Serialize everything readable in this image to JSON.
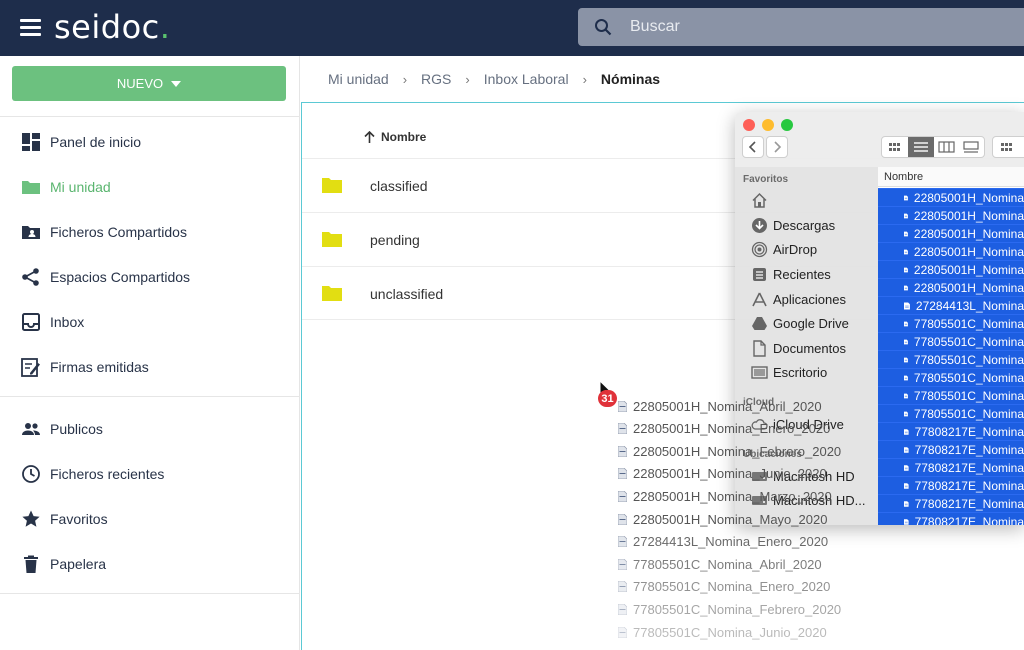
{
  "app": {
    "logo_text": "seidoc",
    "logo_dot": ".",
    "accent": "#6cc17f",
    "topbar_color": "#1e2d4b"
  },
  "search": {
    "placeholder": "Buscar"
  },
  "sidebar": {
    "new_button": "NUEVO",
    "items": [
      {
        "label": "Panel de inicio",
        "icon": "dashboard-icon"
      },
      {
        "label": "Mi unidad",
        "icon": "folder-icon",
        "active": true
      },
      {
        "label": "Ficheros Compartidos",
        "icon": "shared-folder-icon"
      },
      {
        "label": "Espacios Compartidos",
        "icon": "share-icon"
      },
      {
        "label": "Inbox",
        "icon": "inbox-icon"
      },
      {
        "label": "Firmas emitidas",
        "icon": "signature-icon"
      }
    ],
    "items2": [
      {
        "label": "Publicos",
        "icon": "people-icon"
      },
      {
        "label": "Ficheros recientes",
        "icon": "clock-icon"
      },
      {
        "label": "Favoritos",
        "icon": "star-icon"
      },
      {
        "label": "Papelera",
        "icon": "trash-icon"
      }
    ]
  },
  "breadcrumb": [
    "Mi unidad",
    "RGS",
    "Inbox Laboral",
    "Nóminas"
  ],
  "table": {
    "column": "Nombre",
    "rows": [
      "classified",
      "pending",
      "unclassified"
    ]
  },
  "drag": {
    "count": "31",
    "files": [
      "22805001H_Nomina_Abril_2020",
      "22805001H_Nomina_Enero_2020",
      "22805001H_Nomina_Febrero_2020",
      "22805001H_Nomina_Junio_2020",
      "22805001H_Nomina_Marzo_2020",
      "22805001H_Nomina_Mayo_2020",
      "27284413L_Nomina_Enero_2020",
      "77805501C_Nomina_Abril_2020",
      "77805501C_Nomina_Enero_2020",
      "77805501C_Nomina_Febrero_2020",
      "77805501C_Nomina_Junio_2020"
    ]
  },
  "finder": {
    "favorites_header": "Favoritos",
    "favorites": [
      {
        "label": "",
        "icon": "home-icon"
      },
      {
        "label": "Descargas",
        "icon": "download-icon"
      },
      {
        "label": "AirDrop",
        "icon": "airdrop-icon"
      },
      {
        "label": "Recientes",
        "icon": "recents-icon"
      },
      {
        "label": "Aplicaciones",
        "icon": "applications-icon"
      },
      {
        "label": "Google Drive",
        "icon": "google-drive-icon"
      },
      {
        "label": "Documentos",
        "icon": "documents-icon"
      },
      {
        "label": "Escritorio",
        "icon": "desktop-icon"
      }
    ],
    "icloud_header": "iCloud",
    "icloud": [
      {
        "label": "iCloud Drive",
        "icon": "cloud-icon"
      }
    ],
    "locations_header": "Ubicaciones",
    "locations": [
      {
        "label": "Macintosh HD",
        "icon": "disk-icon"
      },
      {
        "label": "Macintosh HD...",
        "icon": "disk-icon"
      }
    ],
    "list_header": "Nombre",
    "files": [
      "22805001H_Nomina",
      "22805001H_Nomina",
      "22805001H_Nomina",
      "22805001H_Nomina",
      "22805001H_Nomina",
      "22805001H_Nomina",
      "27284413L_Nomina",
      "77805501C_Nomina",
      "77805501C_Nomina",
      "77805501C_Nomina",
      "77805501C_Nomina",
      "77805501C_Nomina",
      "77805501C_Nomina",
      "77808217E_Nomina",
      "77808217E_Nomina",
      "77808217E_Nomina",
      "77808217E_Nomina",
      "77808217E_Nomina",
      "77808217E_Nomina"
    ]
  }
}
